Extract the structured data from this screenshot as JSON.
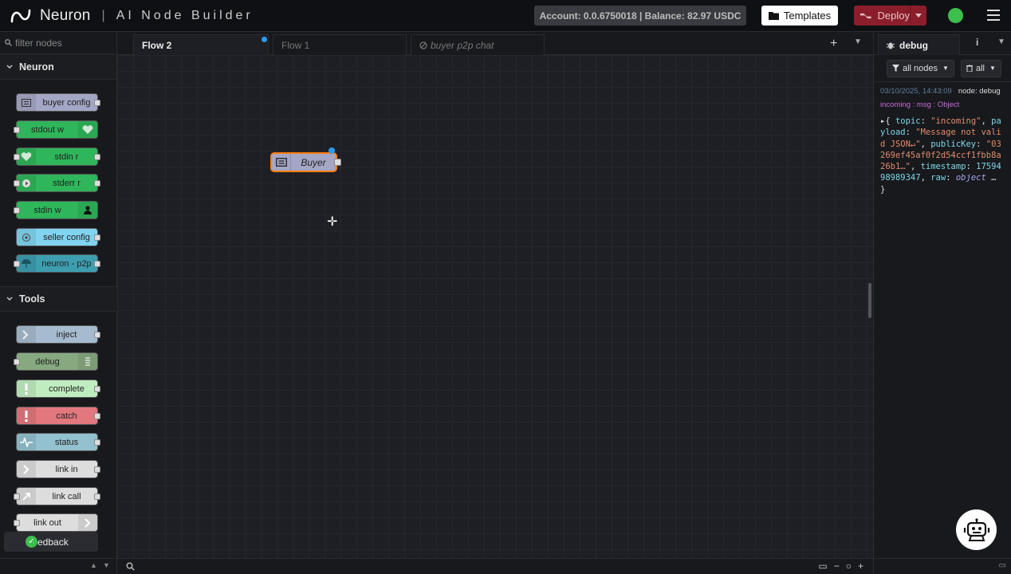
{
  "header": {
    "brand": "Neuron",
    "separator": "|",
    "subtitle": "AI Node Builder",
    "account": "Account: 0.0.6750018 | Balance: 82.97 USDC",
    "templates_label": "Templates",
    "deploy_label": "Deploy",
    "status_color": "#3cbf4d"
  },
  "palette": {
    "filter_placeholder": "filter nodes",
    "categories": [
      {
        "label": "Neuron",
        "nodes": [
          "buyer config",
          "stdout w",
          "stdin r",
          "stderr r",
          "stdin w",
          "seller config",
          "neuron - p2p"
        ]
      },
      {
        "label": "Tools",
        "nodes": [
          "inject",
          "debug",
          "complete",
          "catch",
          "status",
          "link in",
          "link call",
          "link out"
        ]
      }
    ]
  },
  "tabs": [
    {
      "label": "Flow 2",
      "active": true
    },
    {
      "label": "Flow 1",
      "active": false
    },
    {
      "label": "buyer p2p chat",
      "active": false,
      "disabled": true
    }
  ],
  "workspace": {
    "node_label": "Buyer"
  },
  "sidebar": {
    "tab_label": "debug",
    "filter_nodes": "all nodes",
    "clear_label": "all",
    "message": {
      "timestamp": "03/10/2025, 14:43:09",
      "node": "node: debug",
      "topic_line": "incoming : msg : Object",
      "key_topic": "topic",
      "val_topic": "\"incoming\"",
      "key_payload": "payload",
      "val_payload": "\"Message not valid JSON↵\"",
      "key_publicKey": "publicKey",
      "val_publicKey": "\"03269ef45af0f2d54ccf1fbb8a26b1…\"",
      "key_timestamp": "timestamp",
      "val_timestamp": "1759498989347",
      "key_raw": "raw",
      "val_raw": "object"
    }
  },
  "feedback": {
    "label": "Feedback"
  }
}
